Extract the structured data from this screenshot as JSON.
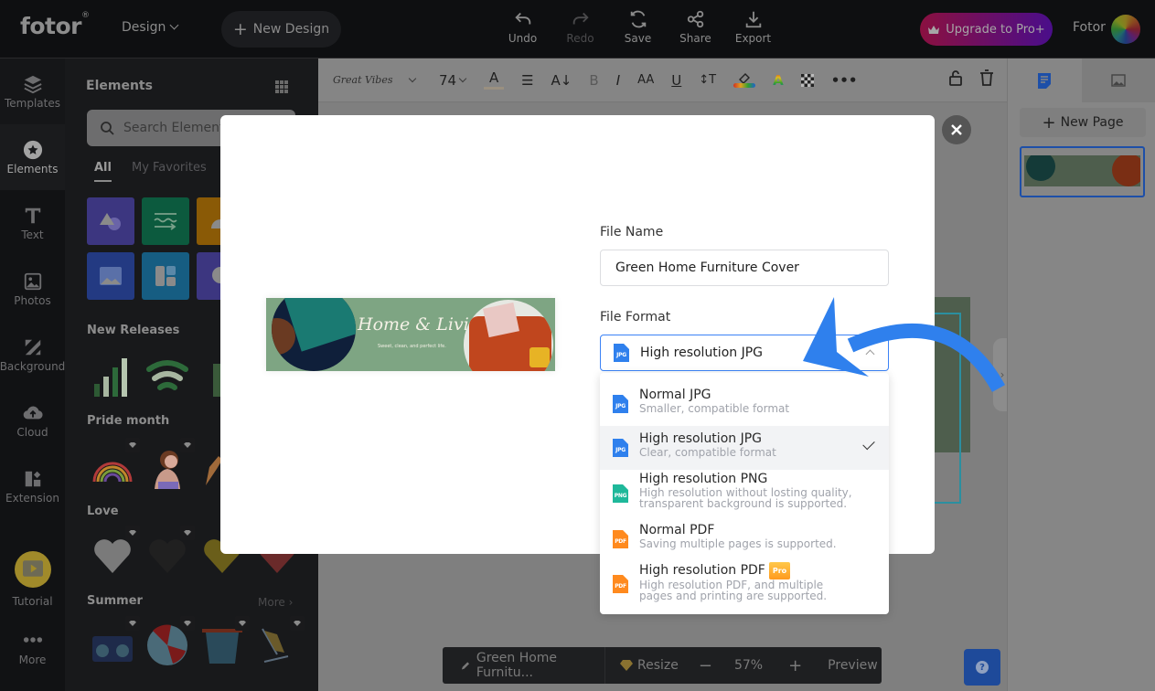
{
  "topbar": {
    "logo": "fotor",
    "logo_mark": "®",
    "design_menu": "Design",
    "new_design": "New Design",
    "tools": [
      {
        "label": "Undo",
        "icon": "undo-icon",
        "enabled": true
      },
      {
        "label": "Redo",
        "icon": "redo-icon",
        "enabled": false
      },
      {
        "label": "Save",
        "icon": "save-icon",
        "enabled": true
      },
      {
        "label": "Share",
        "icon": "share-icon",
        "enabled": true
      },
      {
        "label": "Export",
        "icon": "export-icon",
        "enabled": true
      }
    ],
    "upgrade": "Upgrade to Pro+",
    "user_name": "Fotor"
  },
  "rail": {
    "items": [
      {
        "label": "Templates",
        "icon": "layers-icon"
      },
      {
        "label": "Elements",
        "icon": "star-circle-icon",
        "active": true
      },
      {
        "label": "Text",
        "icon": "text-icon"
      },
      {
        "label": "Photos",
        "icon": "photo-icon"
      },
      {
        "label": "Background",
        "icon": "background-icon"
      },
      {
        "label": "Cloud",
        "icon": "cloud-upload-icon"
      },
      {
        "label": "Extension",
        "icon": "extension-icon"
      },
      {
        "label": "Tutorial",
        "icon": "play-icon"
      },
      {
        "label": "More",
        "icon": "more-dots-icon"
      }
    ]
  },
  "panel": {
    "title": "Elements",
    "search_placeholder": "Search Elements",
    "tabs": [
      "All",
      "My Favorites"
    ],
    "categories": [
      {
        "name": "shapes",
        "color": "#3c3680"
      },
      {
        "name": "lines",
        "color": "#0c5a3e"
      },
      {
        "name": "stickers",
        "color": "#8a5a06"
      },
      {
        "name": "frames",
        "color": "#233a82"
      },
      {
        "name": "grids",
        "color": "#165d82"
      },
      {
        "name": "chat-bubbles",
        "color": "#3c3680"
      }
    ],
    "sections": [
      {
        "title": "New Releases"
      },
      {
        "title": "Pride month"
      },
      {
        "title": "Love"
      },
      {
        "title": "Summer",
        "more": "More"
      }
    ]
  },
  "toolbar": {
    "font_name": "Great Vibes",
    "font_size": "74"
  },
  "right_panel": {
    "new_page": "New Page"
  },
  "bottom_bar": {
    "design_name": "Green Home Furnitu...",
    "resize": "Resize",
    "zoom": "57%",
    "preview": "Preview"
  },
  "banner": {
    "title": "Home & Living",
    "subtitle": "Sweet, clean, and perfect life."
  },
  "export_dialog": {
    "file_name_label": "File Name",
    "file_name_value": "Green Home Furniture Cover",
    "file_format_label": "File Format",
    "selected_format": "High resolution JPG",
    "selected_format_icon": "JPG",
    "options": [
      {
        "title": "Normal JPG",
        "desc": "Smaller, compatible format",
        "icon": "JPG",
        "color": "#2f80ed"
      },
      {
        "title": "High resolution JPG",
        "desc": "Clear, compatible format",
        "icon": "JPG",
        "color": "#2f80ed",
        "selected": true
      },
      {
        "title": "High resolution PNG",
        "desc": "High resolution without losting quality, transparent background is supported.",
        "icon": "PNG",
        "color": "#1fb89a"
      },
      {
        "title": "Normal PDF",
        "desc": "Saving multiple pages is supported.",
        "icon": "PDF",
        "color": "#ff8a1e"
      },
      {
        "title": "High resolution PDF",
        "desc": "High resolution PDF, and multiple pages and printing are supported.",
        "icon": "PDF",
        "color": "#ff8a1e",
        "badge": "Pro"
      }
    ]
  },
  "colors": {
    "accent": "#3b82f6",
    "arrow": "#2f80ed",
    "upgrade_start": "#8a1040",
    "upgrade_end": "#4a0e8a"
  }
}
